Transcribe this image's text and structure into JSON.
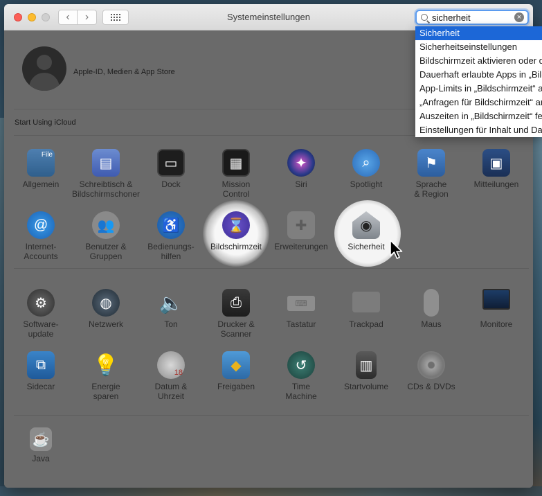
{
  "window": {
    "title": "Systemeinstellungen"
  },
  "search": {
    "value": "sicherheit",
    "clear_label": "×"
  },
  "nav": {
    "back": "‹",
    "forward": "›"
  },
  "apple_id": {
    "label": "Apple-ID, Medien & App Store"
  },
  "icloud": {
    "label": "Start Using iCloud"
  },
  "suggestions": [
    "Sicherheit",
    "Sicherheitseinstellungen",
    "Bildschirmzeit aktivieren oder d",
    "Dauerhaft erlaubte Apps in „Bild",
    "App-Limits in „Bildschirmzeit“ a",
    "„Anfragen für Bildschirmzeit“ ar",
    "Auszeiten in „Bildschirmzeit“ fe",
    "Einstellungen für Inhalt und Dat"
  ],
  "panes": {
    "allgemein": "Allgemein",
    "schreibtisch": "Schreibtisch &\nBildschirmschoner",
    "dock": "Dock",
    "mission": "Mission\nControl",
    "siri": "Siri",
    "spotlight": "Spotlight",
    "sprache": "Sprache\n& Region",
    "mitteilungen": "Mitteilungen",
    "internet": "Internet-\nAccounts",
    "benutzer": "Benutzer &\nGruppen",
    "bedienung": "Bedienungs-\nhilfen",
    "bildschirmzeit": "Bildschirmzeit",
    "erweiterungen": "Erweiterungen",
    "sicherheit": "Sicherheit",
    "software": "Software-\nupdate",
    "netzwerk": "Netzwerk",
    "ton": "Ton",
    "drucker": "Drucker &\nScanner",
    "tastatur": "Tastatur",
    "trackpad": "Trackpad",
    "maus": "Maus",
    "monitore": "Monitore",
    "sidecar": "Sidecar",
    "energie": "Energie\nsparen",
    "datum": "Datum &\nUhrzeit",
    "freigaben": "Freigaben",
    "timemachine": "Time\nMachine",
    "startvolume": "Startvolume",
    "cds": "CDs & DVDs",
    "java": "Java"
  },
  "icon_text": {
    "allgemein": "File",
    "datum_day": "18"
  },
  "colors": {
    "selection": "#1c67d7",
    "search_focus": "#5b9bef"
  }
}
